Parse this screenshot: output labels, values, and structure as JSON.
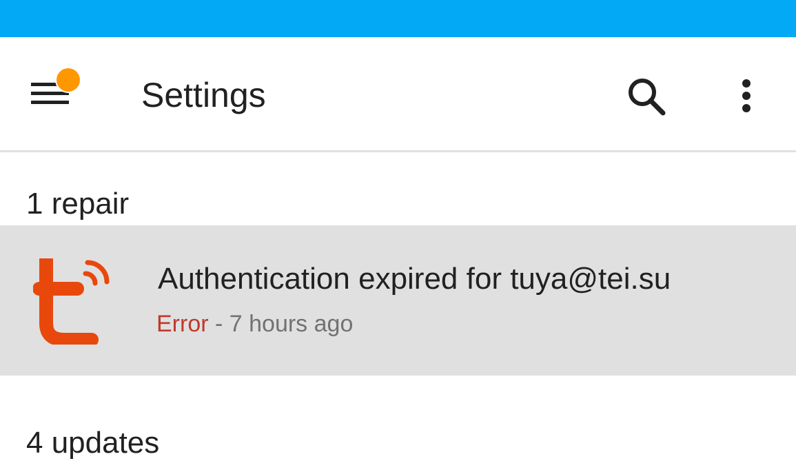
{
  "header": {
    "title": "Settings",
    "menu_icon": "hamburger-menu-icon",
    "notification_dot_color": "#ff9800",
    "search_icon": "search-icon",
    "overflow_icon": "more-vert-icon"
  },
  "colors": {
    "status_bar": "#03a9f4",
    "repair_background": "#e0e0e0",
    "error_text": "#c0392b",
    "tuya_brand": "#e8480c"
  },
  "repairs": {
    "header": "1 repair",
    "items": [
      {
        "icon": "tuya-logo-icon",
        "title": "Authentication expired for tuya@tei.su",
        "severity": "Error",
        "separator": " - ",
        "time": "7 hours ago"
      }
    ]
  },
  "updates": {
    "header": "4 updates"
  }
}
